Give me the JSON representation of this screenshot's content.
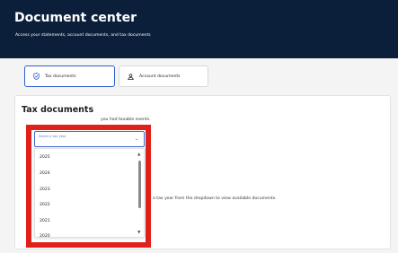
{
  "header": {
    "title": "Document center",
    "subtitle": "Access your statements, account documents, and tax documents"
  },
  "tabs": [
    {
      "label": "Tax documents",
      "icon": "shield-check-icon",
      "active": true
    },
    {
      "label": "Account documents",
      "icon": "person-icon",
      "active": false
    }
  ],
  "tax_section": {
    "title": "Tax documents",
    "description_visible": "you had taxable events.",
    "hint_visible": "a tax year from the dropdown to view available documents."
  },
  "year_select": {
    "placeholder": "Select a tax year",
    "options": [
      "2025",
      "2024",
      "2023",
      "2022",
      "2021",
      "2020"
    ]
  },
  "colors": {
    "header_bg": "#0b1f3b",
    "accent": "#2d5fd0",
    "highlight": "#e0201a"
  }
}
